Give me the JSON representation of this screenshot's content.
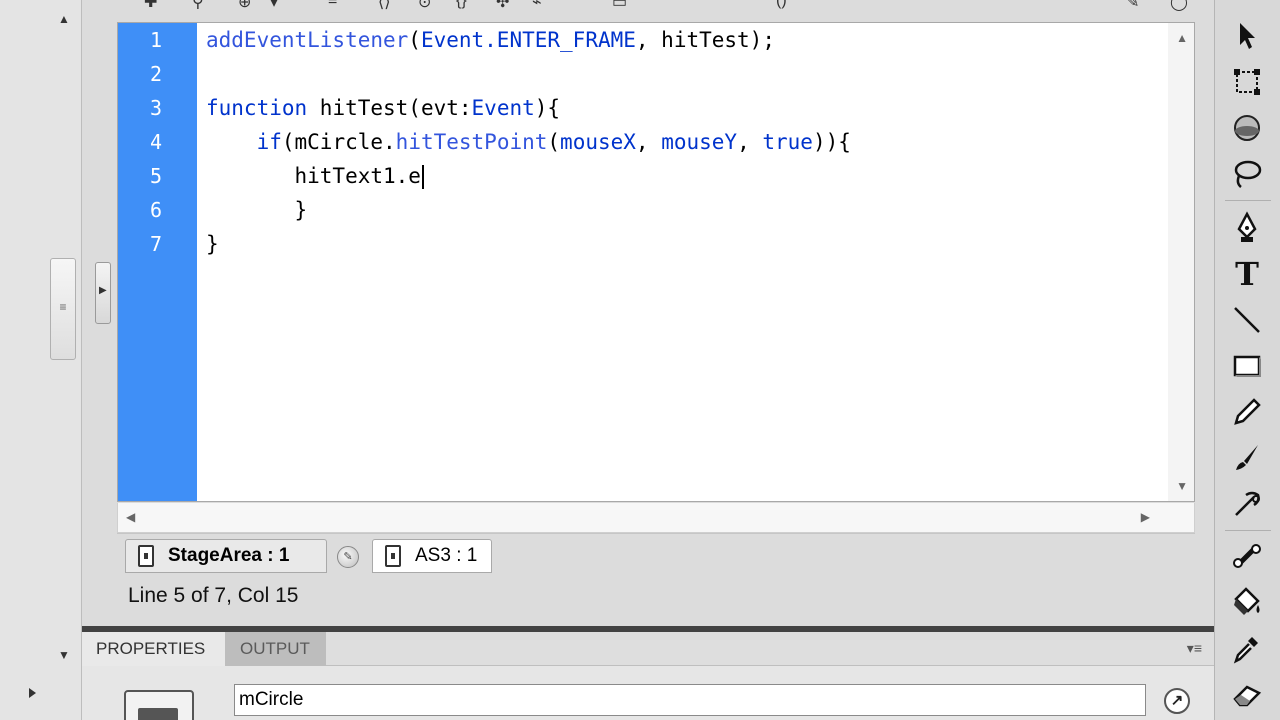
{
  "editor": {
    "lines": [
      {
        "num": "1",
        "parts": [
          {
            "t": "addEventListener",
            "c": "fn"
          },
          {
            "t": "(",
            "c": ""
          },
          {
            "t": "Event.ENTER_FRAME",
            "c": "kw"
          },
          {
            "t": ", hitTest);",
            "c": ""
          }
        ]
      },
      {
        "num": "2",
        "parts": []
      },
      {
        "num": "3",
        "parts": [
          {
            "t": "function",
            "c": "kw"
          },
          {
            "t": " hitTest(evt:",
            "c": ""
          },
          {
            "t": "Event",
            "c": "kw"
          },
          {
            "t": "){",
            "c": ""
          }
        ]
      },
      {
        "num": "4",
        "parts": [
          {
            "t": "    ",
            "c": ""
          },
          {
            "t": "if",
            "c": "kw"
          },
          {
            "t": "(mCircle.",
            "c": ""
          },
          {
            "t": "hitTestPoint",
            "c": "fn"
          },
          {
            "t": "(",
            "c": ""
          },
          {
            "t": "mouseX",
            "c": "kw"
          },
          {
            "t": ", ",
            "c": ""
          },
          {
            "t": "mouseY",
            "c": "kw"
          },
          {
            "t": ", ",
            "c": ""
          },
          {
            "t": "true",
            "c": "kw"
          },
          {
            "t": ")){",
            "c": ""
          }
        ]
      },
      {
        "num": "5",
        "parts": [
          {
            "t": "       hitText1.e",
            "c": ""
          }
        ],
        "cursor": true
      },
      {
        "num": "6",
        "parts": [
          {
            "t": "       }",
            "c": ""
          }
        ]
      },
      {
        "num": "7",
        "parts": [
          {
            "t": "}",
            "c": ""
          }
        ]
      }
    ]
  },
  "tabs": {
    "stage": "StageArea : 1",
    "as3": "AS3 : 1"
  },
  "status": {
    "position": "Line 5 of 7, Col 15"
  },
  "properties": {
    "tab_properties": "PROPERTIES",
    "tab_output": "OUTPUT",
    "instance_name": "mCircle"
  },
  "icons": {
    "pin": "pin-script-icon",
    "swap": "swap-symbol-icon",
    "tools": [
      "selection-tool-icon",
      "free-transform-tool-icon",
      "3d-rotation-tool-icon",
      "lasso-tool-icon",
      "pen-tool-icon",
      "text-tool-icon",
      "line-tool-icon",
      "rectangle-tool-icon",
      "pencil-tool-icon",
      "brush-tool-icon",
      "deco-tool-icon",
      "bone-tool-icon",
      "paint-bucket-tool-icon",
      "eyedropper-tool-icon",
      "eraser-tool-icon"
    ]
  },
  "colors": {
    "gutter": "#3f8ff7",
    "keyword": "#0033cc",
    "panel_separator": "#424242"
  }
}
